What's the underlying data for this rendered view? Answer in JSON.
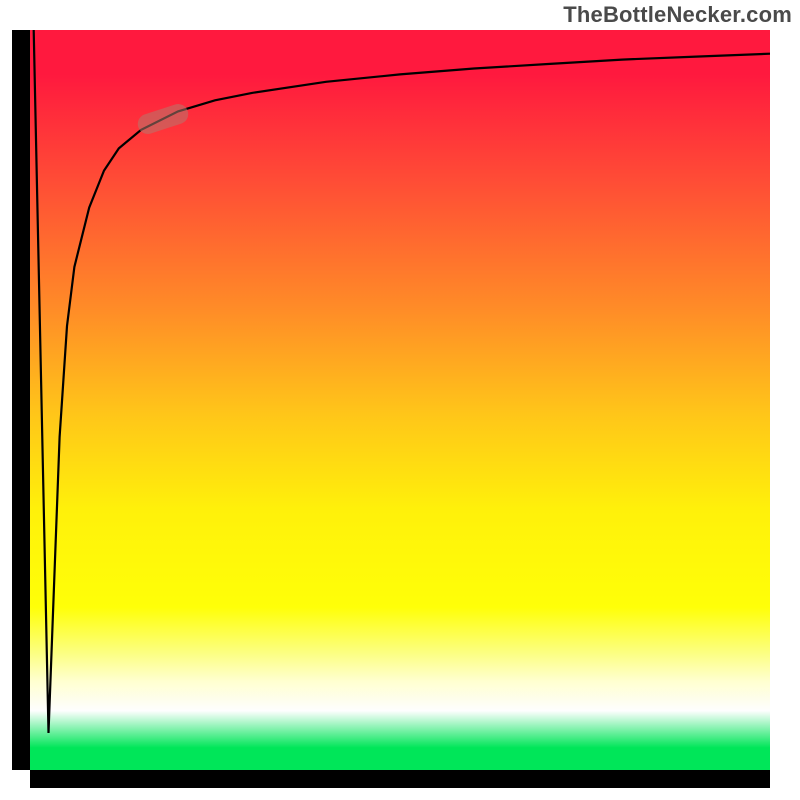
{
  "attribution": {
    "text": "TheBottleNecker.com"
  },
  "chart_data": {
    "type": "line",
    "title": "",
    "xlabel": "",
    "ylabel": "",
    "xlim": [
      0,
      100
    ],
    "ylim": [
      0,
      100
    ],
    "background_gradient": [
      {
        "pos": 0,
        "color": "#ff193e"
      },
      {
        "pos": 20,
        "color": "#ff4b36"
      },
      {
        "pos": 38,
        "color": "#ff8d27"
      },
      {
        "pos": 52,
        "color": "#ffc619"
      },
      {
        "pos": 65,
        "color": "#fff10a"
      },
      {
        "pos": 78,
        "color": "#ffff08"
      },
      {
        "pos": 88,
        "color": "#fcff7e"
      },
      {
        "pos": 92,
        "color": "#fefefe"
      },
      {
        "pos": 97,
        "color": "#00e659"
      }
    ],
    "series": [
      {
        "name": "curve",
        "x": [
          0.5,
          2.5,
          4,
          5,
          6,
          8,
          10,
          12,
          15,
          20,
          25,
          30,
          40,
          50,
          60,
          70,
          80,
          90,
          100
        ],
        "y": [
          100,
          5,
          45,
          60,
          68,
          76,
          81,
          84,
          86.5,
          89,
          90.5,
          91.5,
          93,
          94,
          94.8,
          95.4,
          96,
          96.4,
          96.8
        ]
      }
    ],
    "marker": {
      "series": "curve",
      "x": 18,
      "y": 88,
      "angle_deg": -18,
      "shape": "pill",
      "color": "rgba(180,120,110,0.55)"
    },
    "axes": {
      "left_bar_color": "#000000",
      "bottom_bar_color": "#000000",
      "show_ticks": false,
      "show_grid": false
    }
  }
}
